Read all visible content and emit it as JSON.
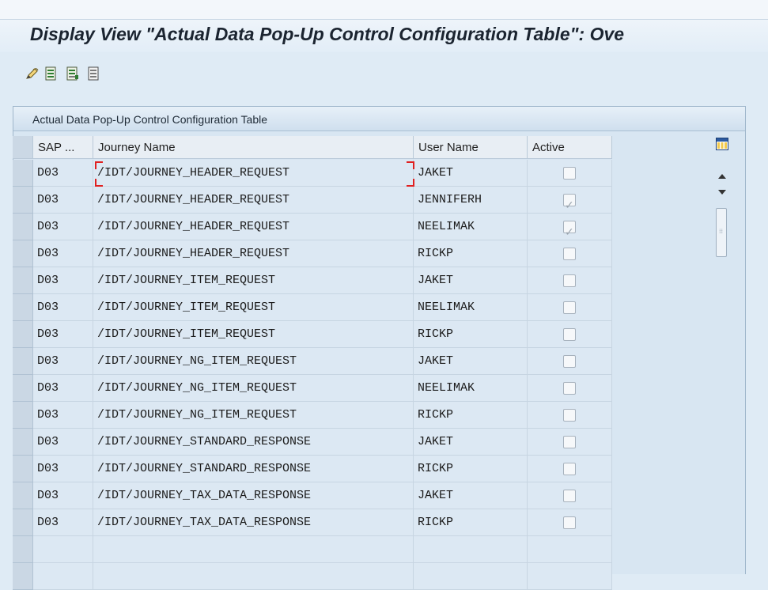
{
  "window": {
    "title": "Display View \"Actual Data Pop-Up Control Configuration Table\": Ove"
  },
  "toolbar": {
    "icons": [
      "edit-pencil-icon",
      "select-all-icon",
      "select-block-icon",
      "deselect-all-icon"
    ]
  },
  "panel": {
    "title": "Actual Data Pop-Up Control Configuration Table"
  },
  "table": {
    "headers": {
      "sap": "SAP ...",
      "journey": "Journey Name",
      "user": "User Name",
      "active": "Active"
    },
    "rows": [
      {
        "sap": "D03",
        "journey": "/IDT/JOURNEY_HEADER_REQUEST",
        "user": "JAKET",
        "active": false
      },
      {
        "sap": "D03",
        "journey": "/IDT/JOURNEY_HEADER_REQUEST",
        "user": "JENNIFERH",
        "active": true
      },
      {
        "sap": "D03",
        "journey": "/IDT/JOURNEY_HEADER_REQUEST",
        "user": "NEELIMAK",
        "active": true
      },
      {
        "sap": "D03",
        "journey": "/IDT/JOURNEY_HEADER_REQUEST",
        "user": "RICKP",
        "active": false
      },
      {
        "sap": "D03",
        "journey": "/IDT/JOURNEY_ITEM_REQUEST",
        "user": "JAKET",
        "active": false
      },
      {
        "sap": "D03",
        "journey": "/IDT/JOURNEY_ITEM_REQUEST",
        "user": "NEELIMAK",
        "active": false
      },
      {
        "sap": "D03",
        "journey": "/IDT/JOURNEY_ITEM_REQUEST",
        "user": "RICKP",
        "active": false
      },
      {
        "sap": "D03",
        "journey": "/IDT/JOURNEY_NG_ITEM_REQUEST",
        "user": "JAKET",
        "active": false
      },
      {
        "sap": "D03",
        "journey": "/IDT/JOURNEY_NG_ITEM_REQUEST",
        "user": "NEELIMAK",
        "active": false
      },
      {
        "sap": "D03",
        "journey": "/IDT/JOURNEY_NG_ITEM_REQUEST",
        "user": "RICKP",
        "active": false
      },
      {
        "sap": "D03",
        "journey": "/IDT/JOURNEY_STANDARD_RESPONSE",
        "user": "JAKET",
        "active": false
      },
      {
        "sap": "D03",
        "journey": "/IDT/JOURNEY_STANDARD_RESPONSE",
        "user": "RICKP",
        "active": false
      },
      {
        "sap": "D03",
        "journey": "/IDT/JOURNEY_TAX_DATA_RESPONSE",
        "user": "JAKET",
        "active": false
      },
      {
        "sap": "D03",
        "journey": "/IDT/JOURNEY_TAX_DATA_RESPONSE",
        "user": "RICKP",
        "active": false
      }
    ],
    "empty_rows": 2
  }
}
